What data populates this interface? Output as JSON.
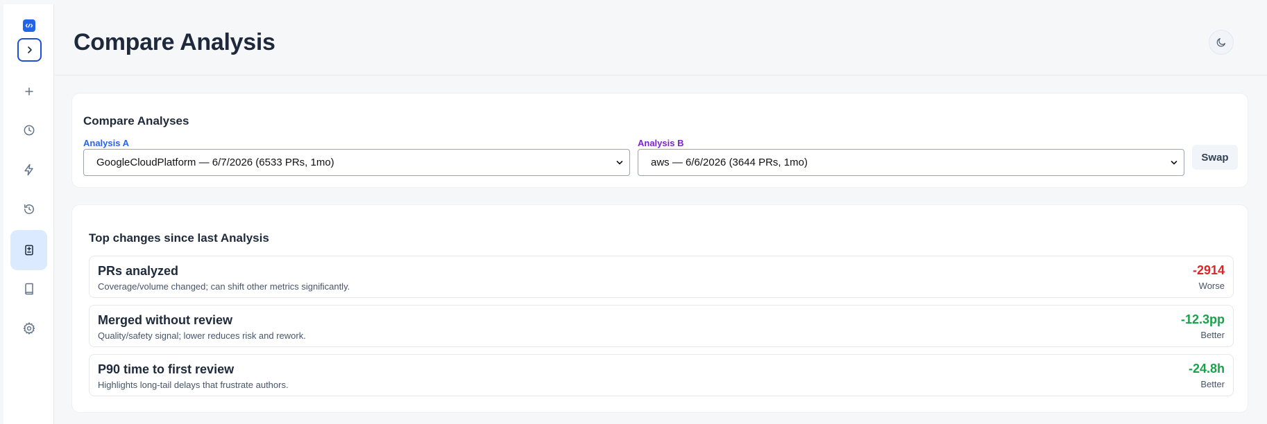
{
  "header": {
    "title": "Compare Analysis"
  },
  "compare": {
    "title": "Compare Analyses",
    "analysis_a_label": "Analysis A",
    "analysis_a_value": "GoogleCloudPlatform — 6/7/2026 (6533 PRs, 1mo)",
    "analysis_b_label": "Analysis B",
    "analysis_b_value": "aws — 6/6/2026 (3644 PRs, 1mo)",
    "swap_label": "Swap"
  },
  "changes": {
    "title": "Top changes since last Analysis",
    "items": [
      {
        "title": "PRs analyzed",
        "description": "Coverage/volume changed; can shift other metrics significantly.",
        "value": "-2914",
        "verdict": "Worse",
        "color": "#dc2626"
      },
      {
        "title": "Merged without review",
        "description": "Quality/safety signal; lower reduces risk and rework.",
        "value": "-12.3pp",
        "verdict": "Better",
        "color": "#16a34a"
      },
      {
        "title": "P90 time to first review",
        "description": "Highlights long-tail delays that frustrate authors.",
        "value": "-24.8h",
        "verdict": "Better",
        "color": "#16a34a"
      }
    ]
  },
  "sidebar": {
    "icons": [
      "plus-icon",
      "clock-icon",
      "lightning-icon",
      "history-icon",
      "compare-icon",
      "book-icon",
      "gear-icon"
    ],
    "active": "compare-icon"
  },
  "colors": {
    "accent": "#2563eb",
    "analysis_b": "#7e22ce",
    "worse": "#dc2626",
    "better": "#16a34a"
  }
}
